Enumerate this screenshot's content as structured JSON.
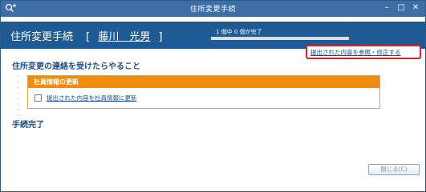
{
  "window": {
    "title": "住所変更手続",
    "controls": {
      "minimize": "–",
      "maximize": "□",
      "close": "✕"
    }
  },
  "header": {
    "title": "住所変更手続",
    "bracket_open": "[",
    "employee_name": "藤川　光男",
    "bracket_close": "]",
    "progress_text": "1 個中 0 個が完了",
    "progress_fraction": 0
  },
  "reference_link": "提出された内容を参照・修正する",
  "section": {
    "title": "住所変更の連絡を受けたらやること"
  },
  "task_card": {
    "header": "社員情報の更新",
    "item_label": "提出された内容を社員情報に更新",
    "checked": false
  },
  "completion_title": "手続完了",
  "close_button": "閉じる(C)",
  "colors": {
    "titlebar": "#3d6fa6",
    "header_bg": "#1e5b94",
    "accent_orange": "#f08c10",
    "highlight_red": "#e02020",
    "link_blue": "#1a4d8f"
  }
}
